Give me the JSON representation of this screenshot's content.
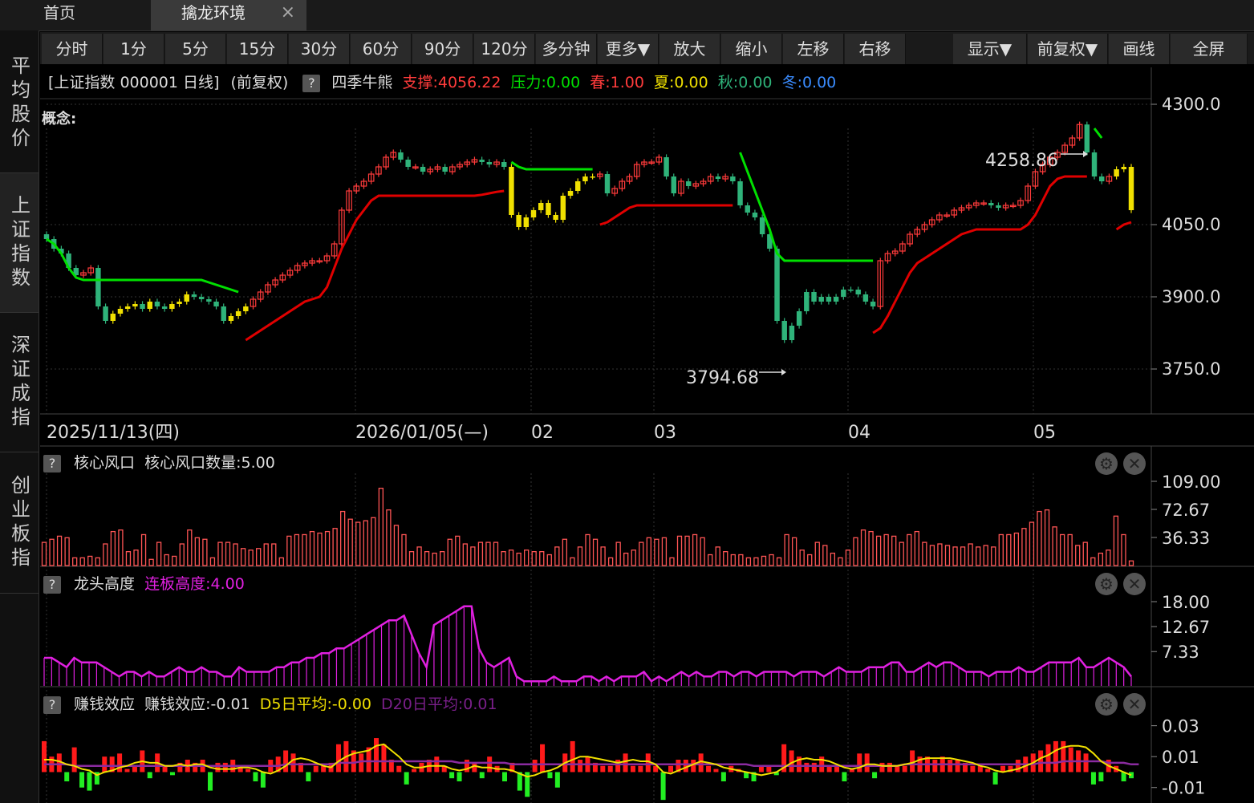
{
  "tabs": {
    "home": "首页",
    "active": "擒龙环境",
    "close": "×"
  },
  "sidebar": [
    "平均股价",
    "上证指数",
    "深证成指",
    "创业板指"
  ],
  "toolbar": [
    "分时",
    "1分",
    "5分",
    "15分",
    "30分",
    "60分",
    "90分",
    "120分",
    "多分钟",
    "更多▼",
    "放大",
    "缩小",
    "左移",
    "右移",
    "显示▼",
    "前复权▼",
    "画线",
    "全屏"
  ],
  "header": {
    "title": "[上证指数 000001 日线]",
    "adjust": "(前复权)",
    "indicator": "四季牛熊",
    "support": "支撑:4056.22",
    "pressure": "压力:0.00",
    "spring": "春:1.00",
    "summer": "夏:0.00",
    "autumn": "秋:0.00",
    "winter": "冬:0.00"
  },
  "concept_label": "概念:",
  "price_axis": [
    "4300.0",
    "4050.0",
    "3900.0",
    "3750.0"
  ],
  "annotations": {
    "high": "4258.86",
    "low": "3794.68"
  },
  "date_axis": [
    "2025/11/13(四)",
    "2026/01/05(—)",
    "02",
    "03",
    "04",
    "05"
  ],
  "panels": {
    "core": {
      "name": "核心风口",
      "value": "核心风口数量:5.00",
      "axis": [
        "109.00",
        "72.67",
        "36.33"
      ]
    },
    "dragon": {
      "name": "龙头高度",
      "value": "连板高度:4.00",
      "axis": [
        "18.00",
        "12.67",
        "7.33"
      ]
    },
    "money": {
      "name": "赚钱效应",
      "value": "赚钱效应:-0.01",
      "d5": "D5日平均:-0.00",
      "d20": "D20日平均:0.01",
      "axis": [
        "0.03",
        "0.01",
        "-0.01"
      ]
    }
  },
  "colors": {
    "up": "#ff3b3b",
    "down": "#2fb37a",
    "yellow": "#f0e000",
    "green": "#00e000",
    "magenta": "#e020e0",
    "axis": "#dddddd"
  },
  "chart_data": [
    {
      "type": "candlestick",
      "title": "",
      "ylim": [
        3700,
        4350
      ],
      "y_ticks": [
        3750,
        3900,
        4050,
        4300
      ],
      "close": [
        4020,
        4000,
        3990,
        3960,
        3945,
        3950,
        3960,
        3880,
        3850,
        3865,
        3875,
        3880,
        3885,
        3875,
        3890,
        3880,
        3875,
        3885,
        3890,
        3905,
        3900,
        3895,
        3890,
        3880,
        3850,
        3860,
        3870,
        3880,
        3895,
        3910,
        3925,
        3935,
        3945,
        3955,
        3965,
        3970,
        3975,
        3975,
        3985,
        4010,
        4080,
        4120,
        4130,
        4140,
        4155,
        4170,
        4190,
        4200,
        4185,
        4170,
        4170,
        4160,
        4165,
        4170,
        4160,
        4170,
        4175,
        4180,
        4185,
        4180,
        4175,
        4180,
        4170,
        4070,
        4045,
        4065,
        4080,
        4095,
        4070,
        4060,
        4110,
        4120,
        4140,
        4150,
        4150,
        4155,
        4115,
        4125,
        4140,
        4150,
        4175,
        4180,
        4180,
        4190,
        4150,
        4115,
        4140,
        4130,
        4135,
        4140,
        4150,
        4145,
        4150,
        4140,
        4090,
        4075,
        4065,
        4030,
        4000,
        3850,
        3810,
        3840,
        3870,
        3910,
        3890,
        3900,
        3890,
        3900,
        3915,
        3915,
        3905,
        3890,
        3880,
        3975,
        3990,
        3995,
        4010,
        4030,
        4040,
        4050,
        4060,
        4070,
        4070,
        4080,
        4085,
        4090,
        4095,
        4095,
        4090,
        4085,
        4090,
        4090,
        4100,
        4130,
        4160,
        4175,
        4190,
        4200,
        4215,
        4230,
        4258,
        4200,
        4150,
        4140,
        4150,
        4165,
        4170,
        4080
      ],
      "support_line": [
        null,
        null,
        null,
        null,
        null,
        null,
        null,
        null,
        null,
        null,
        null,
        null,
        null,
        null,
        null,
        null,
        null,
        null,
        null,
        null,
        null,
        null,
        null,
        null,
        null,
        null,
        null,
        3810,
        3820,
        3830,
        3840,
        3850,
        3860,
        3870,
        3880,
        3890,
        3895,
        3900,
        3920,
        3960,
        4000,
        4030,
        4060,
        4080,
        4100,
        4110,
        4110,
        4110,
        4110,
        4110,
        4110,
        4110,
        4110,
        4110,
        4110,
        4110,
        4110,
        4110,
        4110,
        4112,
        4115,
        4118,
        4120,
        null,
        null,
        null,
        null,
        null,
        null,
        null,
        null,
        null,
        null,
        null,
        null,
        4050,
        4055,
        4065,
        4075,
        4085,
        4090,
        4090,
        4090,
        4090,
        4090,
        4090,
        4090,
        4090,
        4090,
        4090,
        4090,
        4090,
        4090,
        4090,
        null,
        null,
        null,
        null,
        null,
        null,
        null,
        null,
        null,
        null,
        null,
        null,
        null,
        null,
        null,
        null,
        null,
        null,
        3825,
        3835,
        3860,
        3890,
        3920,
        3950,
        3970,
        3980,
        3990,
        4000,
        4010,
        4020,
        4030,
        4035,
        4040,
        4040,
        4040,
        4040,
        4040,
        4040,
        4040,
        4050,
        4070,
        4100,
        4130,
        4145,
        4150,
        4150,
        4150,
        4150,
        null,
        null,
        null,
        4040,
        4050,
        4055
      ],
      "pressure_line": [
        null,
        null,
        null,
        null,
        null,
        null,
        null,
        null,
        null,
        null,
        null,
        null,
        null,
        null,
        null,
        null,
        null,
        null,
        null,
        null,
        null,
        null,
        null,
        null,
        null,
        null,
        null,
        null,
        null,
        null,
        null,
        null,
        null,
        null,
        null,
        null,
        null,
        null,
        null,
        null,
        null,
        null,
        null,
        null,
        null,
        null,
        null,
        null,
        null,
        null,
        null,
        null,
        null,
        null,
        null,
        null,
        null,
        null,
        null,
        null,
        null,
        null,
        null,
        4180,
        4170,
        4165,
        4165,
        4165,
        4165,
        4165,
        4165,
        4165,
        4165,
        4165,
        4165,
        null,
        null,
        null,
        null,
        null,
        null,
        null,
        null,
        null,
        null,
        null,
        null,
        null,
        null,
        null,
        null,
        null,
        null,
        null,
        4200,
        4160,
        4120,
        4080,
        4040,
        3990,
        3975,
        3975,
        3975,
        3975,
        3975,
        3975,
        3975,
        3975,
        3975,
        3975,
        3975,
        3975,
        3975,
        null,
        null,
        null,
        null,
        null,
        null,
        null,
        null,
        null,
        null,
        null,
        null,
        null,
        null,
        null,
        null,
        null,
        null,
        null,
        null,
        null,
        null,
        null,
        null,
        null,
        null,
        null,
        null,
        null,
        4250,
        4230,
        null,
        null,
        null,
        null,
        null,
        null
      ],
      "pressure_line_early": [
        4020,
        4010,
        3990,
        3960,
        3940,
        3935,
        3935,
        3935,
        3935,
        3935,
        3935,
        3935,
        3935,
        3935,
        3935,
        3935,
        3935,
        3935,
        3935,
        3935,
        3935,
        3935,
        3930,
        3925,
        3920,
        3915,
        3910
      ]
    },
    {
      "type": "bar",
      "name": "核心风口",
      "ylim": [
        0,
        109
      ],
      "values": [
        30,
        34,
        38,
        36,
        10,
        10,
        12,
        10,
        28,
        44,
        46,
        18,
        20,
        40,
        8,
        30,
        14,
        12,
        28,
        46,
        36,
        34,
        10,
        30,
        30,
        28,
        22,
        20,
        22,
        28,
        28,
        10,
        38,
        40,
        40,
        44,
        42,
        44,
        48,
        70,
        60,
        56,
        58,
        62,
        100,
        72,
        52,
        40,
        18,
        24,
        18,
        16,
        18,
        34,
        38,
        28,
        24,
        30,
        30,
        30,
        18,
        20,
        16,
        20,
        18,
        18,
        14,
        24,
        34,
        10,
        24,
        40,
        34,
        24,
        10,
        30,
        16,
        20,
        30,
        36,
        34,
        36,
        10,
        38,
        38,
        40,
        36,
        14,
        24,
        18,
        14,
        14,
        10,
        10,
        12,
        14,
        10,
        40,
        36,
        20,
        14,
        30,
        26,
        16,
        10,
        20,
        36,
        46,
        44,
        38,
        40,
        38,
        30,
        40,
        44,
        30,
        26,
        28,
        26,
        24,
        24,
        28,
        24,
        26,
        24,
        40,
        40,
        42,
        48,
        56,
        70,
        72,
        50,
        40,
        40,
        26,
        30,
        10,
        16,
        20,
        64,
        40,
        6
      ]
    },
    {
      "type": "bar",
      "name": "龙头高度",
      "ylim": [
        0,
        18
      ],
      "values": [
        6,
        6,
        5,
        4,
        6,
        5,
        5,
        5,
        4,
        3,
        2,
        3,
        3,
        2,
        3,
        2,
        2,
        3,
        4,
        3,
        3,
        4,
        3,
        3,
        2,
        2,
        4,
        3,
        3,
        3,
        3,
        4,
        4,
        5,
        5,
        6,
        6,
        7,
        7,
        8,
        8,
        9,
        10,
        11,
        12,
        13,
        14,
        14,
        15,
        11,
        7,
        4,
        13,
        14,
        15,
        16,
        17,
        17,
        8,
        5,
        4,
        5,
        6,
        2,
        1,
        1,
        1,
        1,
        2,
        1,
        1,
        1,
        2,
        2,
        1,
        2,
        1,
        2,
        2,
        2,
        3,
        1,
        2,
        1,
        2,
        3,
        2,
        3,
        2,
        2,
        3,
        3,
        2,
        3,
        3,
        2,
        3,
        3,
        3,
        3,
        2,
        3,
        3,
        3,
        2,
        3,
        4,
        3,
        3,
        3,
        4,
        4,
        4,
        5,
        5,
        3,
        3,
        4,
        5,
        4,
        5,
        5,
        4,
        3,
        3,
        3,
        2,
        3,
        3,
        3,
        4,
        3,
        3,
        4,
        5,
        5,
        5,
        5,
        6,
        4,
        4,
        5,
        6,
        5,
        4,
        2
      ]
    },
    {
      "type": "bar",
      "name": "赚钱效应",
      "ylim": [
        -0.02,
        0.035
      ],
      "values": [
        0.02,
        0.01,
        0.012,
        -0.006,
        0.016,
        -0.01,
        -0.012,
        -0.008,
        0.01,
        0.01,
        0.012,
        0.002,
        0.004,
        0.014,
        -0.004,
        0.012,
        0.004,
        -0.002,
        0.006,
        0.008,
        0.006,
        0.008,
        -0.012,
        0.006,
        0.006,
        0.008,
        0.004,
        0.002,
        -0.006,
        -0.01,
        0.008,
        0.01,
        0.014,
        0.012,
        0.006,
        -0.006,
        0.004,
        0.004,
        0.006,
        0.018,
        0.02,
        0.014,
        0.012,
        0.016,
        0.022,
        0.018,
        0.008,
        0.004,
        -0.008,
        0.002,
        0.006,
        0.008,
        0.01,
        0.004,
        -0.004,
        -0.006,
        0.008,
        0.006,
        -0.004,
        0.01,
        0.004,
        -0.006,
        0.006,
        -0.012,
        -0.016,
        0.008,
        0.018,
        -0.004,
        -0.01,
        0.012,
        0.02,
        0.008,
        0.01,
        0.006,
        0.004,
        0.004,
        0.008,
        0.012,
        0.004,
        0.004,
        0.012,
        0.004,
        -0.018,
        0.004,
        0.008,
        0.008,
        0.008,
        0.012,
        0.004,
        0.002,
        -0.006,
        0.004,
        0.002,
        -0.004,
        -0.006,
        0.004,
        0.004,
        -0.002,
        0.018,
        0.014,
        0.01,
        0.006,
        0.006,
        0.01,
        0.004,
        0.004,
        -0.006,
        0.002,
        0.012,
        0.012,
        -0.004,
        0.006,
        0.006,
        0.004,
        0.004,
        0.014,
        0.01,
        0.01,
        0.008,
        0.01,
        0.008,
        0.008,
        0.006,
        0.004,
        0.004,
        0.002,
        -0.008,
        0.004,
        0.004,
        0.008,
        0.01,
        0.012,
        0.014,
        0.018,
        0.02,
        0.02,
        0.016,
        0.014,
        0.012,
        -0.008,
        -0.006,
        0.008,
        0.004,
        -0.006,
        -0.004
      ],
      "d5": [
        0.008,
        0.008,
        0.007,
        0.005,
        0.004,
        0.002,
        0.001,
        -0.002,
        0,
        0.001,
        0.003,
        0.004,
        0.006,
        0.007,
        0.006,
        0.006,
        0.004,
        0.004,
        0.005,
        0.004,
        0.005,
        0.005,
        0.003,
        0.002,
        0.002,
        0.002,
        0.003,
        0.003,
        0.002,
        0,
        -0.001,
        0.001,
        0.004,
        0.008,
        0.009,
        0.008,
        0.006,
        0.004,
        0.003,
        0.007,
        0.01,
        0.012,
        0.013,
        0.014,
        0.017,
        0.018,
        0.014,
        0.01,
        0.005,
        0.003,
        0.003,
        0.004,
        0.004,
        0.004,
        0.002,
        0.001,
        0.002,
        0.004,
        0.003,
        0.003,
        0.002,
        0.002,
        0.001,
        -0.001,
        -0.003,
        -0.002,
        0,
        0.001,
        0.003,
        0.006,
        0.008,
        0.01,
        0.01,
        0.009,
        0.008,
        0.007,
        0.006,
        0.007,
        0.008,
        0.007,
        0.007,
        0.005,
        0,
        -0.001,
        0.001,
        0.003,
        0.005,
        0.007,
        0.006,
        0.005,
        0.003,
        0.002,
        0.001,
        0,
        -0.001,
        -0.002,
        -0.001,
        0,
        0.003,
        0.006,
        0.008,
        0.009,
        0.008,
        0.008,
        0.007,
        0.005,
        0.003,
        0.002,
        0.003,
        0.005,
        0.005,
        0.004,
        0.004,
        0.004,
        0.005,
        0.006,
        0.008,
        0.009,
        0.009,
        0.009,
        0.009,
        0.008,
        0.007,
        0.006,
        0.004,
        0.003,
        0.001,
        0,
        0.001,
        0.002,
        0.004,
        0.006,
        0.009,
        0.011,
        0.014,
        0.016,
        0.017,
        0.017,
        0.016,
        0.012,
        0.007,
        0.004,
        0.002,
        0,
        -0.002
      ],
      "d20": [
        0.005,
        0.005,
        0.005,
        0.005,
        0.004,
        0.004,
        0.004,
        0.004,
        0.004,
        0.004,
        0.004,
        0.004,
        0.004,
        0.004,
        0.004,
        0.004,
        0.004,
        0.004,
        0.004,
        0.004,
        0.004,
        0.004,
        0.004,
        0.004,
        0.004,
        0.004,
        0.004,
        0.004,
        0.004,
        0.004,
        0.004,
        0.004,
        0.005,
        0.005,
        0.005,
        0.005,
        0.005,
        0.005,
        0.005,
        0.006,
        0.006,
        0.006,
        0.007,
        0.007,
        0.007,
        0.007,
        0.007,
        0.007,
        0.007,
        0.007,
        0.007,
        0.007,
        0.007,
        0.007,
        0.007,
        0.006,
        0.006,
        0.006,
        0.006,
        0.006,
        0.006,
        0.006,
        0.005,
        0.005,
        0.005,
        0.005,
        0.005,
        0.005,
        0.005,
        0.005,
        0.005,
        0.005,
        0.005,
        0.005,
        0.005,
        0.005,
        0.005,
        0.005,
        0.005,
        0.005,
        0.005,
        0.005,
        0.005,
        0.005,
        0.005,
        0.005,
        0.005,
        0.005,
        0.005,
        0.005,
        0.005,
        0.005,
        0.005,
        0.005,
        0.004,
        0.004,
        0.004,
        0.004,
        0.004,
        0.004,
        0.004,
        0.004,
        0.004,
        0.004,
        0.004,
        0.004,
        0.004,
        0.004,
        0.004,
        0.004,
        0.004,
        0.004,
        0.004,
        0.004,
        0.005,
        0.005,
        0.005,
        0.005,
        0.005,
        0.005,
        0.005,
        0.005,
        0.005,
        0.005,
        0.005,
        0.005,
        0.005,
        0.005,
        0.005,
        0.005,
        0.005,
        0.005,
        0.006,
        0.006,
        0.006,
        0.007,
        0.007,
        0.007,
        0.007,
        0.007,
        0.007,
        0.006,
        0.006,
        0.006,
        0.005,
        0.005
      ]
    }
  ]
}
